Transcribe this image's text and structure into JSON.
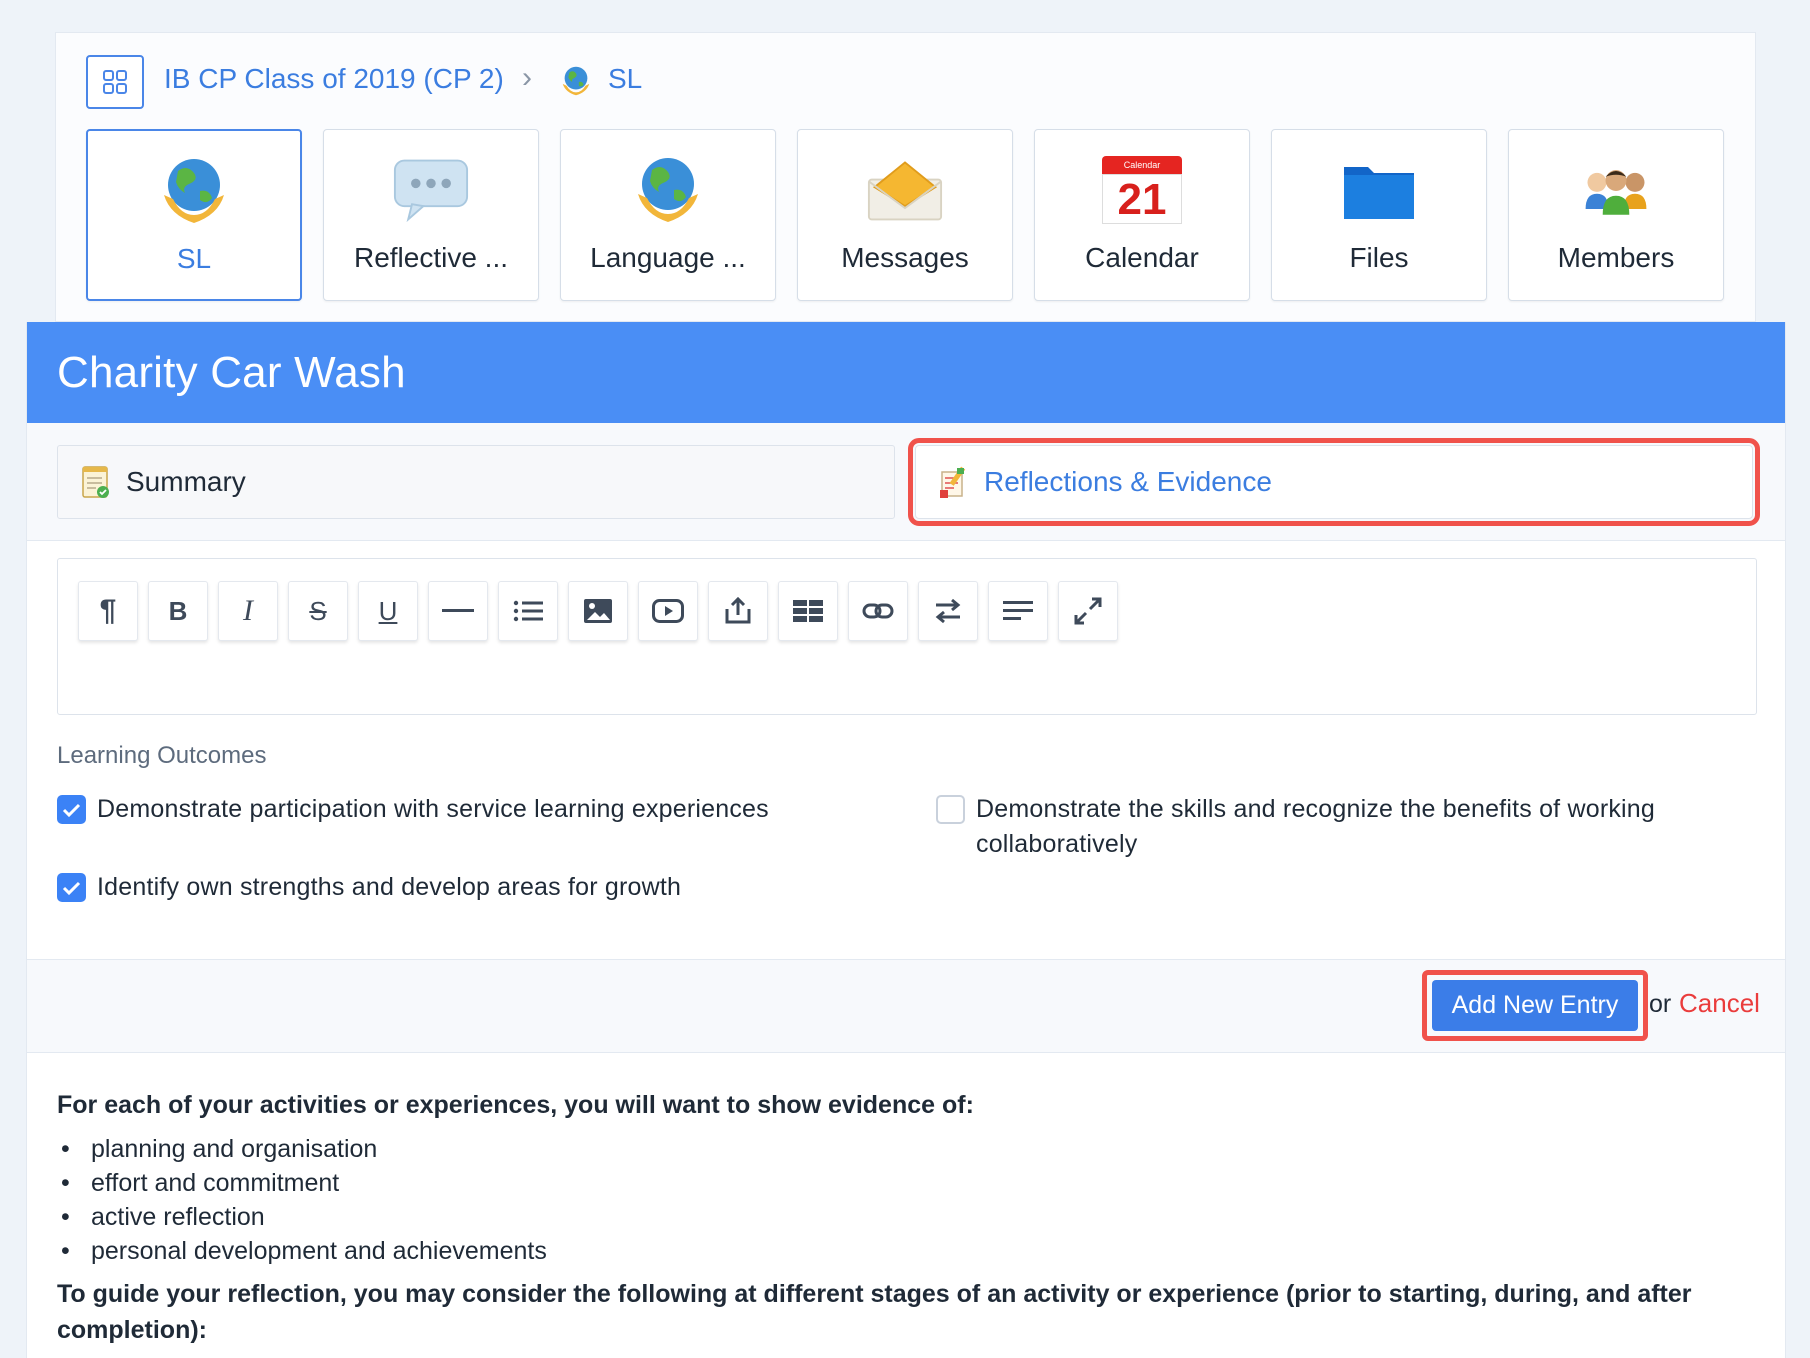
{
  "breadcrumb": {
    "group": "IB CP Class of 2019 (CP 2)",
    "current": "SL"
  },
  "tools": [
    {
      "label": "SL",
      "icon": "globe-hands-icon",
      "active": true
    },
    {
      "label": "Reflective ...",
      "icon": "speech-bubble-icon",
      "active": false
    },
    {
      "label": "Language ...",
      "icon": "globe-hands-icon",
      "active": false
    },
    {
      "label": "Messages",
      "icon": "envelope-icon",
      "active": false
    },
    {
      "label": "Calendar",
      "icon": "calendar-icon",
      "active": false
    },
    {
      "label": "Files",
      "icon": "folder-icon",
      "active": false
    },
    {
      "label": "Members",
      "icon": "members-icon",
      "active": false
    }
  ],
  "calendar_icon": {
    "header": "Calendar",
    "day": "21"
  },
  "page_title": "Charity Car Wash",
  "tabs": {
    "summary": "Summary",
    "reflections": "Reflections & Evidence"
  },
  "editor_toolbar": [
    {
      "name": "paragraph",
      "icon": "paragraph-icon"
    },
    {
      "name": "bold",
      "icon": "bold-icon"
    },
    {
      "name": "italic",
      "icon": "italic-icon"
    },
    {
      "name": "strikethrough",
      "icon": "strikethrough-icon"
    },
    {
      "name": "underline",
      "icon": "underline-icon"
    },
    {
      "name": "horizontal-rule",
      "icon": "horizontal-rule-icon"
    },
    {
      "name": "list",
      "icon": "list-icon"
    },
    {
      "name": "image",
      "icon": "image-icon"
    },
    {
      "name": "video",
      "icon": "video-icon"
    },
    {
      "name": "upload",
      "icon": "upload-icon"
    },
    {
      "name": "table",
      "icon": "table-icon"
    },
    {
      "name": "link",
      "icon": "link-icon"
    },
    {
      "name": "direction",
      "icon": "swap-arrows-icon"
    },
    {
      "name": "align",
      "icon": "align-icon"
    },
    {
      "name": "fullscreen",
      "icon": "expand-icon"
    }
  ],
  "learning_outcomes": {
    "title": "Learning Outcomes",
    "items": [
      {
        "text": "Demonstrate participation with service learning experiences",
        "checked": true
      },
      {
        "text": "Demonstrate the skills and recognize the benefits of working collaboratively",
        "checked": false
      },
      {
        "text": "Identify own strengths and develop areas for growth",
        "checked": true
      }
    ]
  },
  "actions": {
    "add_label": "Add New Entry",
    "or_text": "or",
    "cancel_label": "Cancel"
  },
  "guidance": {
    "intro": "For each of your activities or experiences, you will want to show evidence of:",
    "bullets": [
      "planning and organisation",
      "effort and commitment",
      "active reflection",
      "personal development and achievements"
    ],
    "reflection_prompt": "To guide your reflection, you may consider the following at different stages of an activity or experience (prior to starting, during, and after completion):"
  },
  "colors": {
    "banner": "#4a8ef5",
    "accent": "#3b7de0",
    "highlight": "#f0524b",
    "cancel": "#ea3c3c"
  }
}
